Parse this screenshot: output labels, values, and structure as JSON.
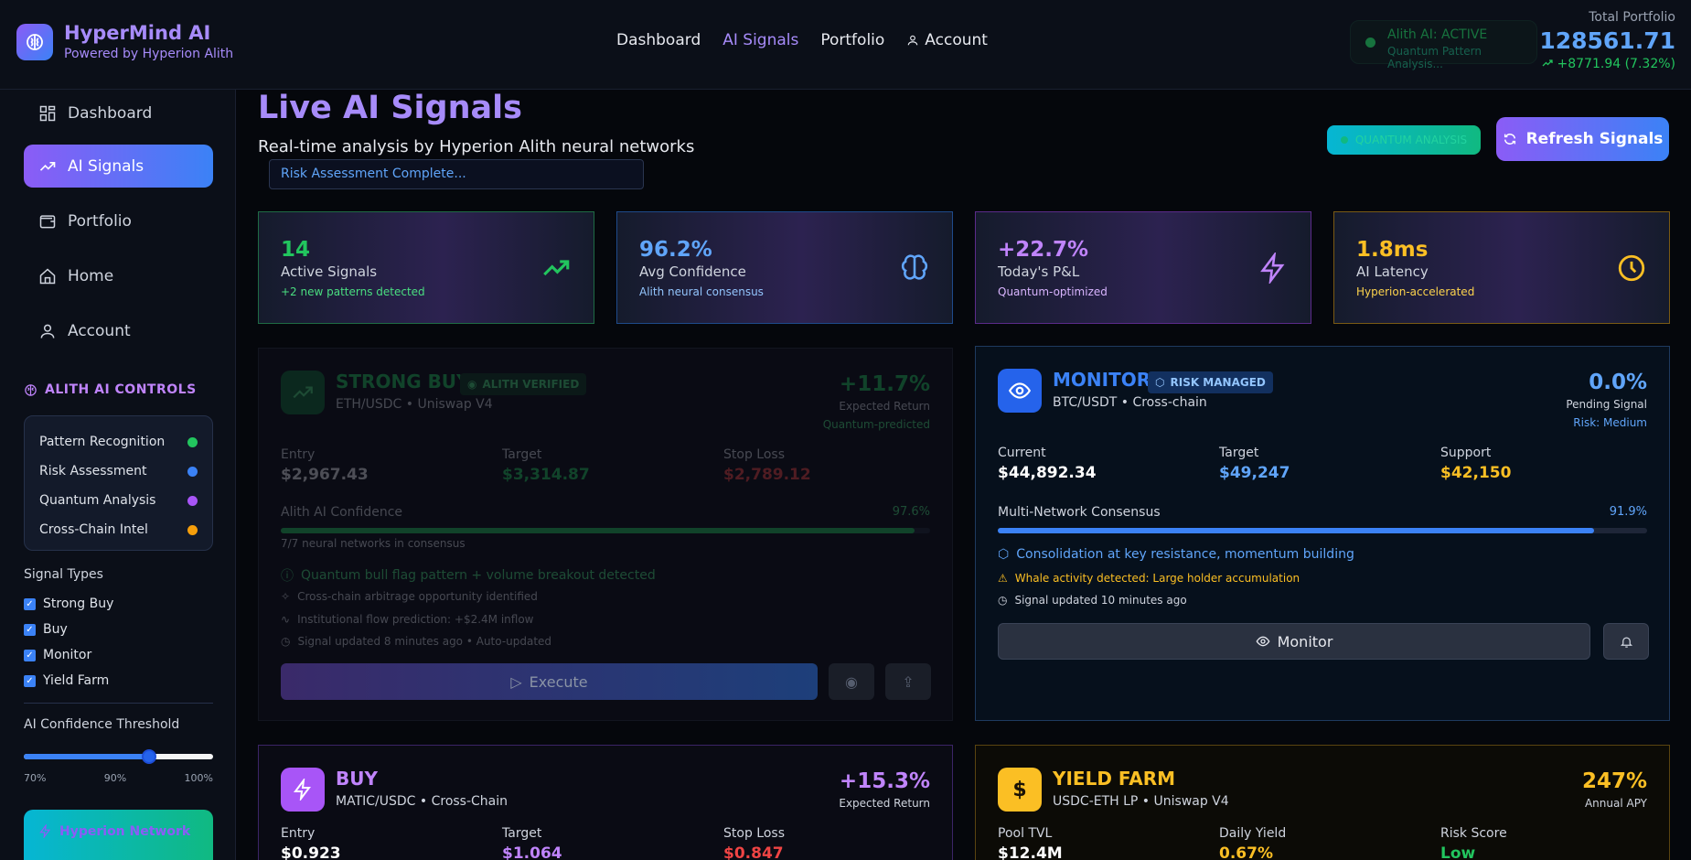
{
  "app": {
    "name": "HyperMind AI",
    "subtitle": "Powered by Hyperion Alith"
  },
  "nav": {
    "items": [
      {
        "label": "Dashboard",
        "active": false
      },
      {
        "label": "AI Signals",
        "active": true
      },
      {
        "label": "Portfolio",
        "active": false
      },
      {
        "label": "Account",
        "active": false
      }
    ]
  },
  "status": {
    "title": "Alith AI: ACTIVE",
    "subtitle": "Quantum Pattern Analysis..."
  },
  "portfolio": {
    "label": "Total Portfolio",
    "value": "128561.71",
    "change": "+8771.94 (7.32%)"
  },
  "sidebar": {
    "items": [
      {
        "label": "Dashboard",
        "icon": "grid-icon",
        "active": false
      },
      {
        "label": "AI Signals",
        "icon": "trending-up-icon",
        "active": true
      },
      {
        "label": "Portfolio",
        "icon": "wallet-icon",
        "active": false
      },
      {
        "label": "Home",
        "icon": "home-icon",
        "active": false
      },
      {
        "label": "Account",
        "icon": "user-icon",
        "active": false
      }
    ],
    "controls_title": "ALITH AI CONTROLS",
    "controls": [
      {
        "label": "Pattern Recognition",
        "color": "#22c55e"
      },
      {
        "label": "Risk Assessment",
        "color": "#3b82f6"
      },
      {
        "label": "Quantum Analysis",
        "color": "#a855f7"
      },
      {
        "label": "Cross-Chain Intel",
        "color": "#f59e0b"
      }
    ],
    "signal_types_title": "Signal Types",
    "signal_types": [
      {
        "label": "Strong Buy",
        "checked": true
      },
      {
        "label": "Buy",
        "checked": true
      },
      {
        "label": "Monitor",
        "checked": true
      },
      {
        "label": "Yield Farm",
        "checked": true
      }
    ],
    "threshold_title": "AI Confidence Threshold",
    "threshold_value_fraction": 0.66,
    "threshold_ticks": [
      "70%",
      "90%",
      "100%"
    ],
    "network_card_title": "Hyperion Network"
  },
  "main": {
    "title": "Live AI Signals",
    "subtitle": "Real-time analysis by Hyperion Alith neural networks",
    "risk_status": "Risk Assessment Complete...",
    "quantum_badge": "QUANTUM ANALYSIS",
    "refresh_label": "Refresh Signals"
  },
  "stats": [
    {
      "value": "14",
      "label": "Active Signals",
      "note": "+2 new patterns detected",
      "value_color": "#22c55e",
      "note_color": "#4ade80",
      "border": "#1f6b44",
      "icon": "trending-up-icon"
    },
    {
      "value": "96.2%",
      "label": "Avg Confidence",
      "note": "Alith neural consensus",
      "value_color": "#60a5fa",
      "note_color": "#93c5fd",
      "border": "#1e4a8a",
      "icon": "brain-icon"
    },
    {
      "value": "+22.7%",
      "label": "Today's P&L",
      "note": "Quantum-optimized",
      "value_color": "#c084fc",
      "note_color": "#d8b4fe",
      "border": "#5b2b8a",
      "icon": "lightning-icon"
    },
    {
      "value": "1.8ms",
      "label": "AI Latency",
      "note": "Hyperion-accelerated",
      "value_color": "#fbbf24",
      "note_color": "#fcd34d",
      "border": "#7a5a14",
      "icon": "clock-icon"
    }
  ],
  "signals": {
    "strong_buy": {
      "type": "STRONG BUY",
      "badge": "ALITH VERIFIED",
      "pair": "ETH/USDC • Uniswap V4",
      "return": "+11.7%",
      "return_label": "Expected Return",
      "return_note": "Quantum-predicted",
      "metrics": [
        {
          "label": "Entry",
          "value": "$2,967.43"
        },
        {
          "label": "Target",
          "value": "$3,314.87"
        },
        {
          "label": "Stop Loss",
          "value": "$2,789.12"
        }
      ],
      "confidence_label": "Alith AI Confidence",
      "confidence": "97.6%",
      "confidence_fraction": 0.976,
      "consensus": "7/7 neural networks in consensus",
      "notes": [
        "Quantum bull flag pattern + volume breakout detected",
        "Cross-chain arbitrage opportunity identified",
        "Institutional flow prediction: +$2.4M inflow",
        "Signal updated 8 minutes ago • Auto-updated"
      ],
      "action": "Execute"
    },
    "monitor": {
      "type": "MONITOR",
      "badge": "RISK MANAGED",
      "pair": "BTC/USDT • Cross-chain",
      "return": "0.0%",
      "return_label": "Pending Signal",
      "return_note": "Risk: Medium",
      "metrics": [
        {
          "label": "Current",
          "value": "$44,892.34"
        },
        {
          "label": "Target",
          "value": "$49,247"
        },
        {
          "label": "Support",
          "value": "$42,150"
        }
      ],
      "confidence_label": "Multi-Network Consensus",
      "confidence": "91.9%",
      "confidence_fraction": 0.919,
      "notes": [
        "Consolidation at key resistance, momentum building",
        "Whale activity detected: Large holder accumulation",
        "Signal updated 10 minutes ago"
      ],
      "action": "Monitor"
    },
    "buy": {
      "type": "BUY",
      "pair": "MATIC/USDC • Cross-Chain",
      "return": "+15.3%",
      "return_label": "Expected Return",
      "metrics": [
        {
          "label": "Entry",
          "value": "$0.923"
        },
        {
          "label": "Target",
          "value": "$1.064"
        },
        {
          "label": "Stop Loss",
          "value": "$0.847"
        }
      ]
    },
    "yield_farm": {
      "type": "YIELD FARM",
      "pair": "USDC-ETH LP • Uniswap V4",
      "return": "247%",
      "return_label": "Annual APY",
      "metrics": [
        {
          "label": "Pool TVL",
          "value": "$12.4M"
        },
        {
          "label": "Daily Yield",
          "value": "0.67%"
        },
        {
          "label": "Risk Score",
          "value": "Low"
        }
      ]
    }
  }
}
